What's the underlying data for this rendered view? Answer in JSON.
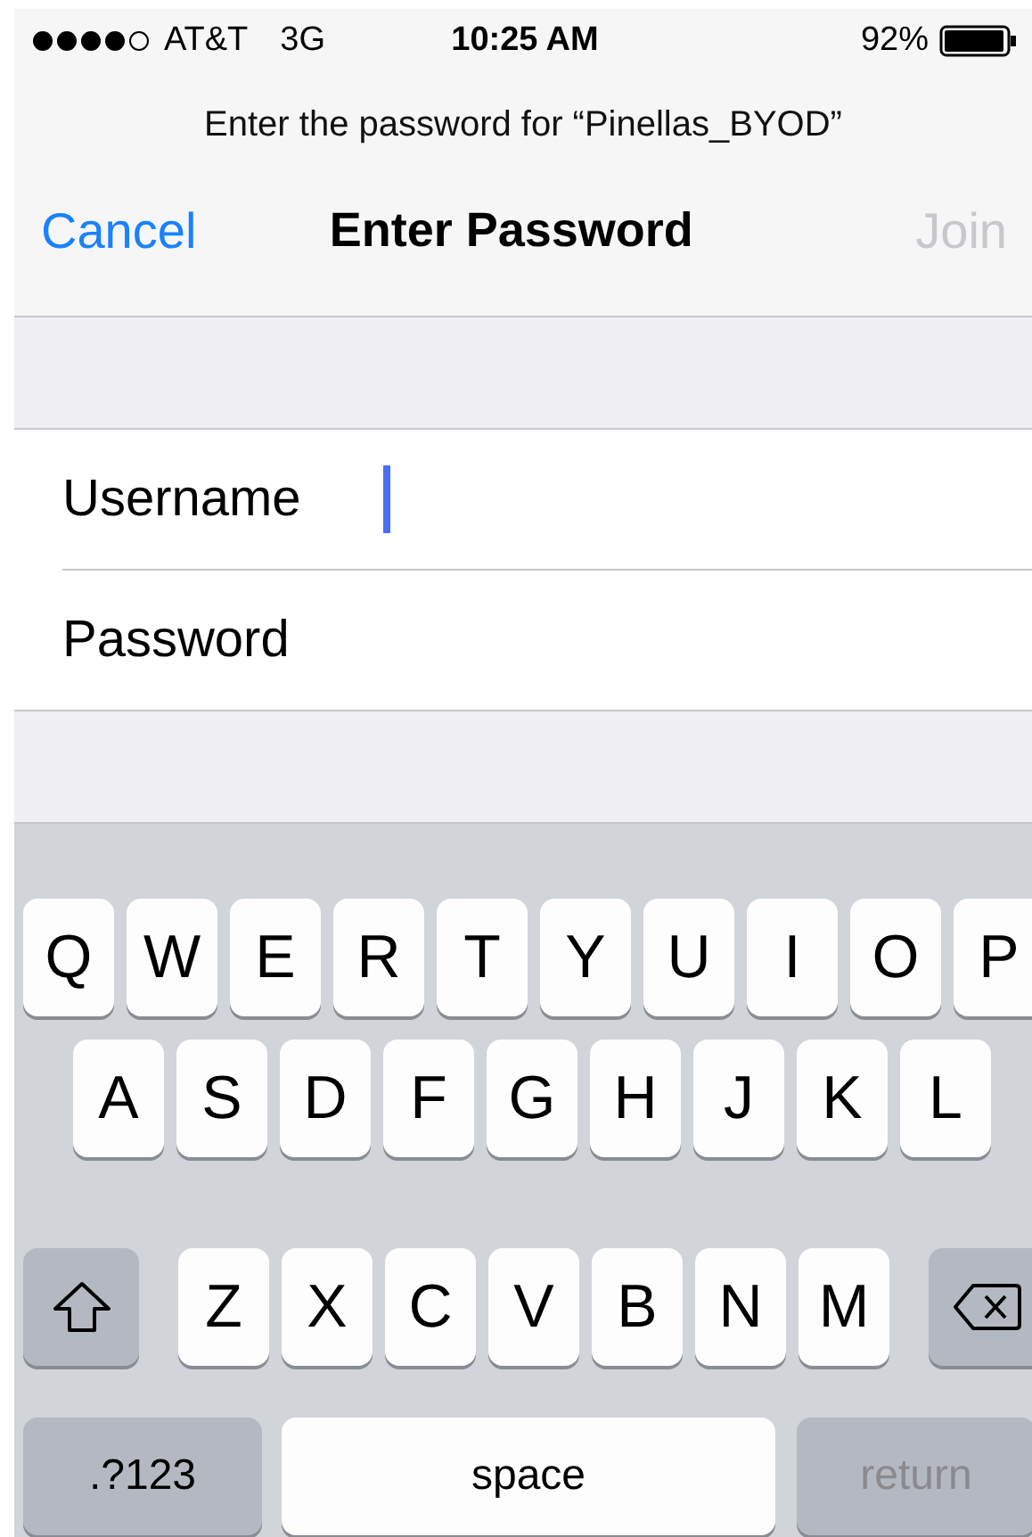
{
  "status_bar": {
    "carrier": "AT&T",
    "network": "3G",
    "time": "10:25 AM",
    "battery": "92%"
  },
  "prompt": "Enter the password for “Pinellas_BYOD”",
  "nav": {
    "cancel": "Cancel",
    "title": "Enter Password",
    "join": {
      "label": "Join",
      "disabled": true
    }
  },
  "fields": [
    {
      "label": "Username",
      "focused": true
    },
    {
      "label": "Password",
      "focused": false
    }
  ],
  "keyboard": {
    "rows": [
      {
        "keys": [
          {
            "kind": "letter",
            "label": "Q"
          },
          {
            "kind": "letter",
            "label": "W"
          },
          {
            "kind": "letter",
            "label": "E"
          },
          {
            "kind": "letter",
            "label": "R"
          },
          {
            "kind": "letter",
            "label": "T"
          },
          {
            "kind": "letter",
            "label": "Y"
          },
          {
            "kind": "letter",
            "label": "U"
          },
          {
            "kind": "letter",
            "label": "I"
          },
          {
            "kind": "letter",
            "label": "O"
          },
          {
            "kind": "letter",
            "label": "P"
          }
        ]
      },
      {
        "keys": [
          {
            "kind": "letter",
            "label": "A"
          },
          {
            "kind": "letter",
            "label": "S"
          },
          {
            "kind": "letter",
            "label": "D"
          },
          {
            "kind": "letter",
            "label": "F"
          },
          {
            "kind": "letter",
            "label": "G"
          },
          {
            "kind": "letter",
            "label": "H"
          },
          {
            "kind": "letter",
            "label": "J"
          },
          {
            "kind": "letter",
            "label": "K"
          },
          {
            "kind": "letter",
            "label": "L"
          }
        ]
      },
      {
        "keys": [
          {
            "kind": "shift"
          },
          {
            "kind": "letter",
            "label": "Z"
          },
          {
            "kind": "letter",
            "label": "X"
          },
          {
            "kind": "letter",
            "label": "C"
          },
          {
            "kind": "letter",
            "label": "V"
          },
          {
            "kind": "letter",
            "label": "B"
          },
          {
            "kind": "letter",
            "label": "N"
          },
          {
            "kind": "letter",
            "label": "M"
          },
          {
            "kind": "delete"
          }
        ]
      },
      {
        "keys": [
          {
            "kind": "numbers",
            "label": ".?123"
          },
          {
            "kind": "space",
            "label": "space"
          },
          {
            "kind": "return",
            "label": "return",
            "disabled": true
          }
        ]
      }
    ]
  }
}
